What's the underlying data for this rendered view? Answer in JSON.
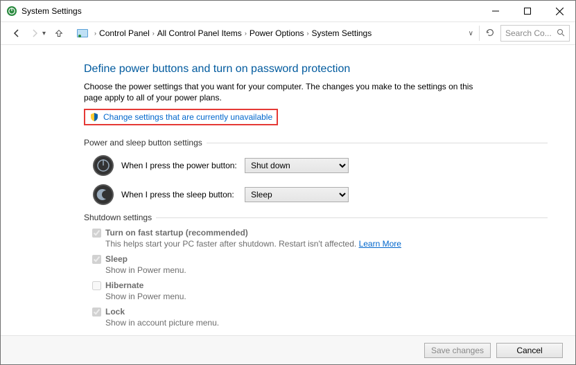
{
  "window": {
    "title": "System Settings"
  },
  "breadcrumb": {
    "items": [
      "Control Panel",
      "All Control Panel Items",
      "Power Options",
      "System Settings"
    ]
  },
  "search": {
    "placeholder": "Search Co..."
  },
  "page": {
    "heading": "Define power buttons and turn on password protection",
    "description": "Choose the power settings that you want for your computer. The changes you make to the settings on this page apply to all of your power plans.",
    "change_link": "Change settings that are currently unavailable"
  },
  "sections": {
    "button_settings_title": "Power and sleep button settings",
    "shutdown_title": "Shutdown settings"
  },
  "button_rows": {
    "power": {
      "label": "When I press the power button:",
      "value": "Shut down"
    },
    "sleep": {
      "label": "When I press the sleep button:",
      "value": "Sleep"
    }
  },
  "shutdown": {
    "fast": {
      "label": "Turn on fast startup (recommended)",
      "desc": "This helps start your PC faster after shutdown. Restart isn't affected. ",
      "link": "Learn More",
      "checked": true
    },
    "sleep": {
      "label": "Sleep",
      "desc": "Show in Power menu.",
      "checked": true
    },
    "hibernate": {
      "label": "Hibernate",
      "desc": "Show in Power menu.",
      "checked": false
    },
    "lock": {
      "label": "Lock",
      "desc": "Show in account picture menu.",
      "checked": true
    }
  },
  "footer": {
    "save": "Save changes",
    "cancel": "Cancel"
  }
}
